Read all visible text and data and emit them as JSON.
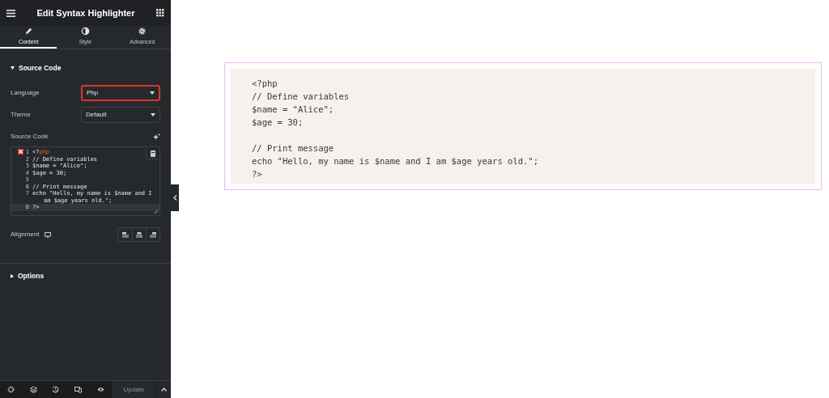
{
  "panel": {
    "title": "Edit Syntax Highlighter",
    "tabs": [
      {
        "label": "Content",
        "selected": true
      },
      {
        "label": "Style",
        "selected": false
      },
      {
        "label": "Advanced",
        "selected": false
      }
    ],
    "sections": [
      {
        "title": "Source Code",
        "expanded": true
      },
      {
        "title": "Options",
        "expanded": false
      }
    ],
    "language": {
      "label": "Language",
      "value": "Php",
      "highlighted": true
    },
    "theme": {
      "label": "Theme",
      "value": "Default",
      "highlighted": false
    },
    "source_code": {
      "label": "Source Code",
      "lines": [
        {
          "number": "1",
          "error": true,
          "active": false,
          "segments": [
            {
              "text": "<?",
              "kind": "plain"
            },
            {
              "text": "php",
              "kind": "keyword"
            }
          ]
        },
        {
          "number": "2",
          "error": false,
          "active": false,
          "segments": [
            {
              "text": "// Define variables",
              "kind": "plain"
            }
          ]
        },
        {
          "number": "3",
          "error": false,
          "active": false,
          "segments": [
            {
              "text": "$name = \"Alice\";",
              "kind": "plain"
            }
          ]
        },
        {
          "number": "4",
          "error": false,
          "active": false,
          "segments": [
            {
              "text": "$age = 30;",
              "kind": "plain"
            }
          ]
        },
        {
          "number": "5",
          "error": false,
          "active": false
        },
        {
          "number": "6",
          "error": false,
          "active": false,
          "segments": [
            {
              "text": "// Print message",
              "kind": "plain"
            }
          ]
        },
        {
          "number": "7",
          "error": false,
          "active": false,
          "segments": [
            {
              "text": "echo \"Hello, my name is $name and I am $age years old.\";",
              "kind": "plain"
            }
          ]
        },
        {
          "number": "8",
          "error": false,
          "active": true,
          "segments": [
            {
              "text": "?>",
              "kind": "plain"
            }
          ]
        }
      ]
    },
    "alignment": {
      "label": "Alignment"
    },
    "footer": {
      "update": "Update"
    }
  },
  "preview": {
    "blocks": [
      [
        "<?php",
        "// Define variables",
        "$name = \"Alice\";",
        "$age = 30;"
      ],
      [
        "// Print message",
        "echo \"Hello, my name is $name and I am $age years old.\";",
        "?>"
      ]
    ]
  }
}
